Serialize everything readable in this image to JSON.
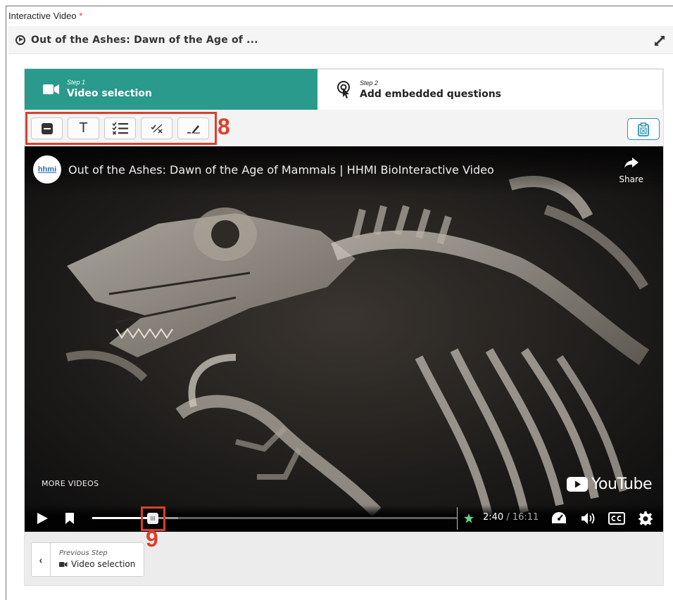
{
  "field": {
    "label": "Interactive Video",
    "required_mark": "*"
  },
  "title_bar": {
    "title": "Out of the Ashes: Dawn of the Age of ..."
  },
  "steps": [
    {
      "step_label": "Step 1",
      "name": "Video selection",
      "active": true
    },
    {
      "step_label": "Step 2",
      "name": "Add embedded questions",
      "active": false
    }
  ],
  "toolbar": {
    "buttons": [
      {
        "icon": "label-icon"
      },
      {
        "icon": "text-icon",
        "glyph": "T"
      },
      {
        "icon": "multiple-choice-icon"
      },
      {
        "icon": "true-false-icon"
      },
      {
        "icon": "fill-in-blanks-icon"
      }
    ],
    "callout": "8",
    "right_button_icon": "clipboard-icon"
  },
  "video": {
    "channel_logo_text": "hhmi",
    "title": "Out of the Ashes: Dawn of the Age of Mammals | HHMI BioInteractive Video",
    "share_label": "Share",
    "more_videos": "MORE VIDEOS",
    "brand": "YouTube",
    "current_time": "2:40",
    "duration": "16:11",
    "time_separator": " / ",
    "progress_fraction": 0.165,
    "callout": "9"
  },
  "footer": {
    "prev_step_label": "Previous Step",
    "prev_step_name": "Video selection",
    "chevron": "‹"
  },
  "colors": {
    "accent": "#2a9a8c",
    "callout": "#d9402c"
  }
}
